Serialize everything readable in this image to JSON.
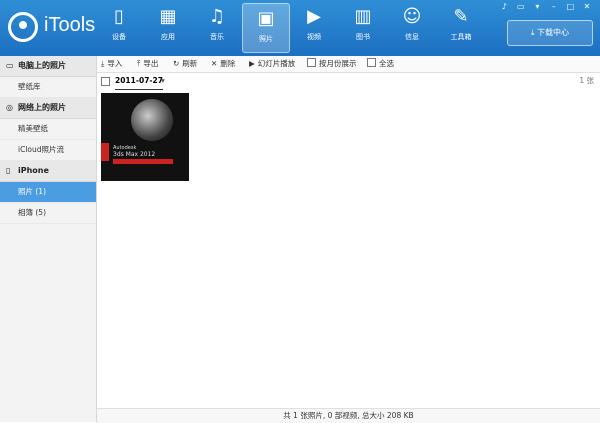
{
  "app": {
    "title": "iTools"
  },
  "nav": [
    {
      "label": "设备",
      "icon": "phone-icon",
      "glyph": "▯"
    },
    {
      "label": "应用",
      "icon": "apps-icon",
      "glyph": "▦"
    },
    {
      "label": "音乐",
      "icon": "music-icon",
      "glyph": "♫"
    },
    {
      "label": "照片",
      "icon": "photo-icon",
      "glyph": "▣"
    },
    {
      "label": "视频",
      "icon": "video-icon",
      "glyph": "▶"
    },
    {
      "label": "图书",
      "icon": "book-icon",
      "glyph": "▥"
    },
    {
      "label": "信息",
      "icon": "user-icon",
      "glyph": "☺"
    },
    {
      "label": "工具箱",
      "icon": "wrench-icon",
      "glyph": "✎"
    }
  ],
  "nav_active": 3,
  "header": {
    "download_label": "下载中心"
  },
  "sidebar": {
    "sections": [
      {
        "title": "电脑上的照片",
        "items": [
          {
            "label": "壁纸库"
          }
        ]
      },
      {
        "title": "网络上的照片",
        "items": [
          {
            "label": "精美壁纸"
          },
          {
            "label": "iCloud照片流"
          }
        ]
      },
      {
        "title": "iPhone",
        "items": [
          {
            "label": "照片 (1)"
          },
          {
            "label": "相簿 (5)"
          }
        ]
      }
    ]
  },
  "toolbar": {
    "import": "导入",
    "export": "导出",
    "refresh": "刷新",
    "delete": "删除",
    "slideshow": "幻灯片播放",
    "by_month": "按月份展示",
    "select_all": "全选"
  },
  "date_group": {
    "date": "2011-07-27",
    "count": "1 张"
  },
  "photo": {
    "line1": "Autodesk",
    "line2": "3ds Max 2012"
  },
  "status": "共 1 张照片, 0 部视频, 总大小 208 KB",
  "colors": {
    "header": "#2f8fd6",
    "active": "#4a9de0"
  }
}
